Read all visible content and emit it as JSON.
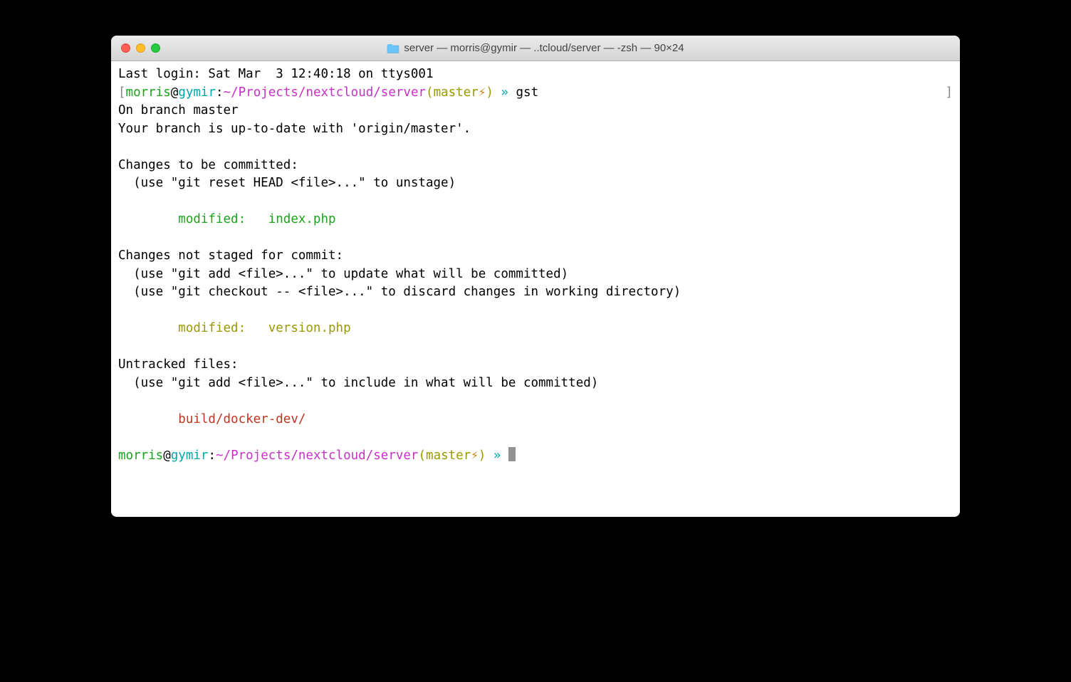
{
  "window": {
    "title": "server — morris@gymir — ..tcloud/server — -zsh — 90×24"
  },
  "terminal": {
    "last_login": "Last login: Sat Mar  3 12:40:18 on ttys001",
    "prompt1": {
      "open_bracket": "[",
      "user": "morris",
      "at": "@",
      "host": "gymir",
      "colon": ":",
      "path": "~/Projects/nextcloud/server",
      "branch_open": "(",
      "branch": "master",
      "bolt": "⚡",
      "branch_close": ")",
      "arrow": " » ",
      "command": "gst",
      "close_bracket": "]"
    },
    "status": {
      "branch_line": "On branch master",
      "uptodate": "Your branch is up-to-date with 'origin/master'.",
      "staged_header": "Changes to be committed:",
      "staged_hint": "  (use \"git reset HEAD <file>...\" to unstage)",
      "staged_file": "        modified:   index.php",
      "unstaged_header": "Changes not staged for commit:",
      "unstaged_hint1": "  (use \"git add <file>...\" to update what will be committed)",
      "unstaged_hint2": "  (use \"git checkout -- <file>...\" to discard changes in working directory)",
      "unstaged_file": "        modified:   version.php",
      "untracked_header": "Untracked files:",
      "untracked_hint": "  (use \"git add <file>...\" to include in what will be committed)",
      "untracked_file": "        build/docker-dev/"
    },
    "prompt2": {
      "user": "morris",
      "at": "@",
      "host": "gymir",
      "colon": ":",
      "path": "~/Projects/nextcloud/server",
      "branch_open": "(",
      "branch": "master",
      "bolt": "⚡",
      "branch_close": ")",
      "arrow": " » "
    }
  }
}
